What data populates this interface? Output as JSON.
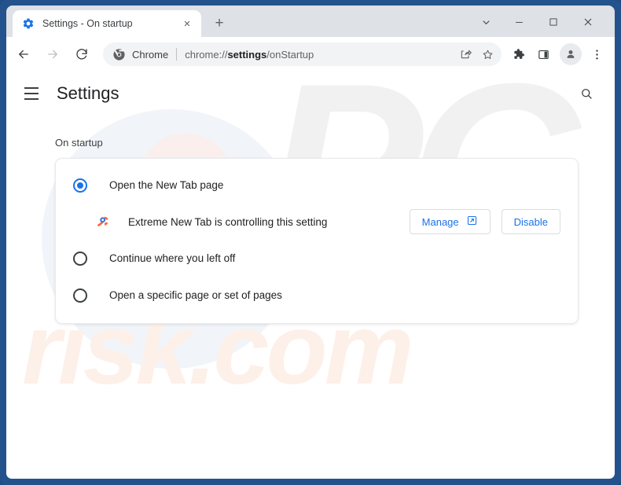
{
  "window": {
    "controls": {
      "expand": "expand-chevron",
      "minimize": "minimize",
      "maximize": "maximize",
      "close": "close"
    }
  },
  "tabstrip": {
    "tabs": [
      {
        "favicon": "settings-gear-icon",
        "title": "Settings - On startup",
        "close_label": "×"
      }
    ],
    "new_tab_label": "+"
  },
  "toolbar": {
    "back_label": "←",
    "forward_label": "→",
    "reload_label": "reload-icon",
    "omnibox": {
      "chip_label": "Chrome",
      "url_prefix": "chrome://",
      "url_bold": "settings",
      "url_suffix": "/onStartup",
      "share_icon": "share-icon",
      "bookmark_icon": "star-icon"
    },
    "extensions_icon": "puzzle-icon",
    "side_panel_icon": "side-panel-icon",
    "profile_icon": "avatar-icon",
    "menu_icon": "three-dot-menu-icon"
  },
  "settings": {
    "menu_label": "hamburger-menu-icon",
    "title": "Settings",
    "search_label": "search-icon",
    "section_label": "On startup",
    "options": [
      {
        "label": "Open the New Tab page",
        "selected": true
      },
      {
        "label": "Continue where you left off",
        "selected": false
      },
      {
        "label": "Open a specific page or set of pages",
        "selected": false
      }
    ],
    "controlled_notice": {
      "icon": "extension-icon",
      "text": "Extreme New Tab is controlling this setting",
      "manage_label": "Manage",
      "manage_icon": "external-link-icon",
      "disable_label": "Disable"
    }
  },
  "watermarks": {
    "logo_text": "PC",
    "domain_text": "risk.com"
  },
  "colors": {
    "frame_blue": "#24528c",
    "accent_blue": "#1a73e8",
    "tabstrip_gray": "#dee1e6",
    "omnibox_gray": "#f1f3f4"
  }
}
